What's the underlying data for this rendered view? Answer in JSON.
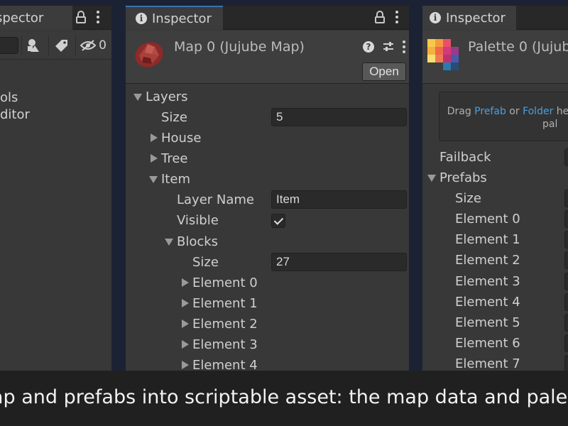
{
  "left_panel": {
    "tab_title": "spector",
    "eye_count": "0",
    "items": [
      "ols",
      "ditor"
    ]
  },
  "middle_panel": {
    "tab_title": "Inspector",
    "asset_title": "Map 0 (Jujube Map)",
    "open_label": "Open",
    "rows": {
      "layers": "Layers",
      "size_label": "Size",
      "size_value": "5",
      "house": "House",
      "tree": "Tree",
      "item": "Item",
      "layer_name_label": "Layer Name",
      "layer_name_value": "Item",
      "visible_label": "Visible",
      "blocks": "Blocks",
      "blocks_size_label": "Size",
      "blocks_size_value": "27",
      "elements": [
        "Element 0",
        "Element 1",
        "Element 2",
        "Element 3",
        "Element 4"
      ]
    }
  },
  "right_panel": {
    "tab_title": "Inspector",
    "asset_title": "Palette 0 (Jujub",
    "drop_hint": {
      "prefix": "Drag ",
      "link1": "Prefab",
      "middle": " or ",
      "link2": "Folder",
      "suffix": " he",
      "line2": "pal"
    },
    "failback_label": "Failback",
    "prefabs_label": "Prefabs",
    "size_label": "Size",
    "elements": [
      "Element 0",
      "Element 1",
      "Element 2",
      "Element 3",
      "Element 4",
      "Element 5",
      "Element 6",
      "Element 7"
    ]
  },
  "caption": {
    "text": "ap and prefabs into scriptable asset: the map data and palette"
  },
  "colors": {
    "accent_link": "#4a9fe0",
    "active_tab": "#3a72b0",
    "background": "#1b2233"
  }
}
